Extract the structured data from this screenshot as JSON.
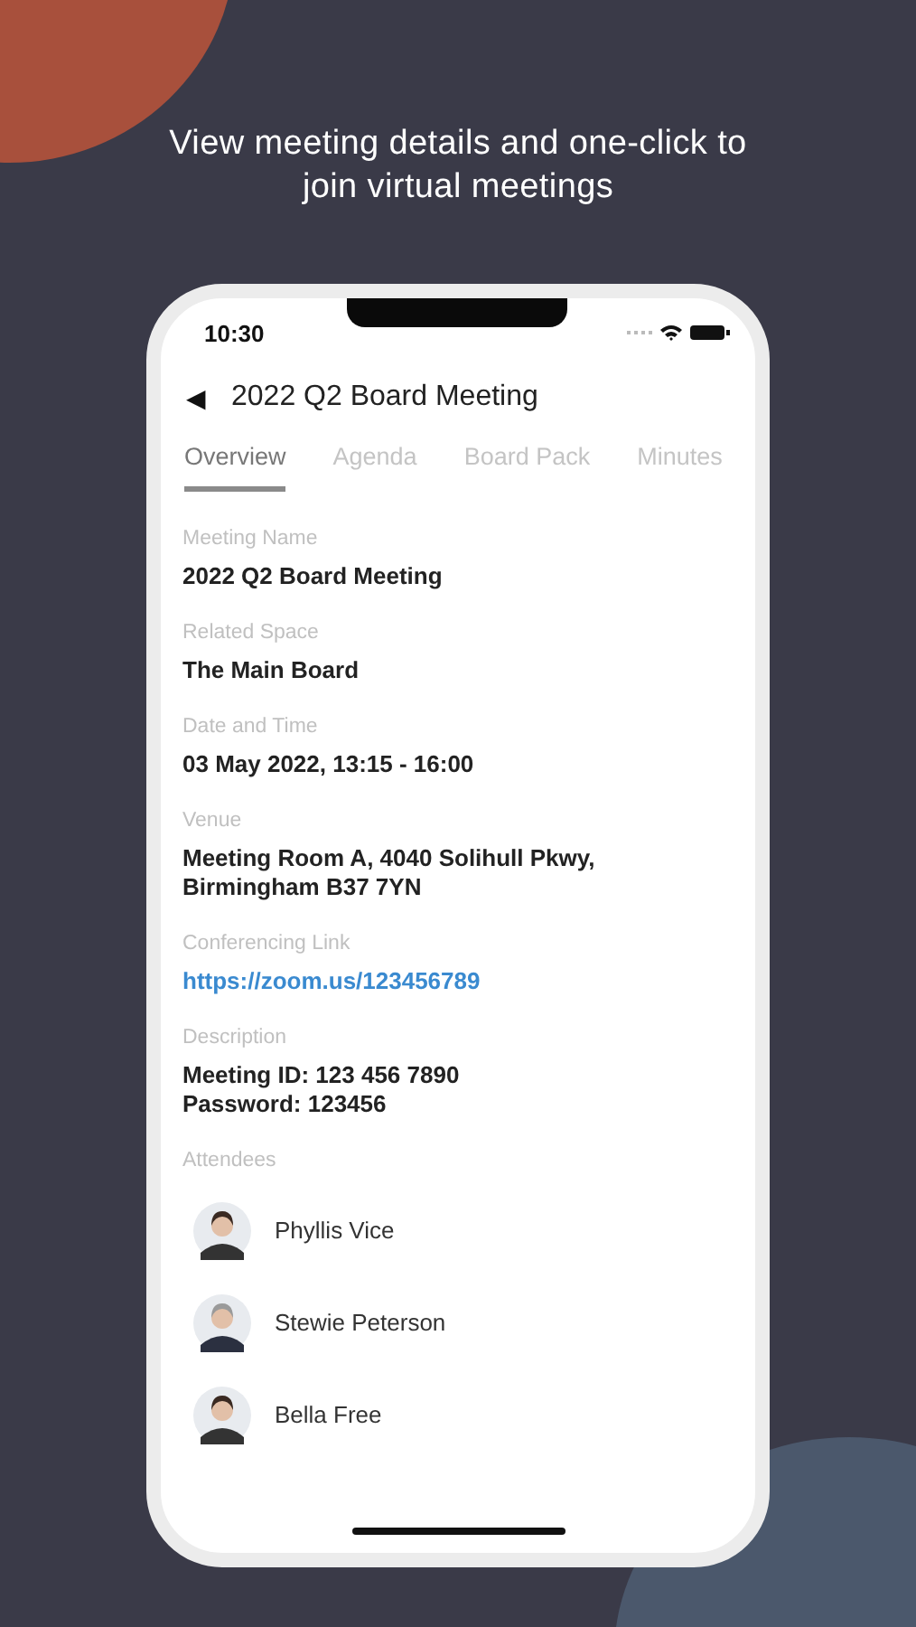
{
  "headline": "View meeting details and one-click to join virtual meetings",
  "status_bar": {
    "time": "10:30"
  },
  "header": {
    "back": "◀",
    "title": "2022 Q2 Board Meeting"
  },
  "tabs": [
    {
      "label": "Overview",
      "selected": true
    },
    {
      "label": "Agenda",
      "selected": false
    },
    {
      "label": "Board Pack",
      "selected": false
    },
    {
      "label": "Minutes",
      "selected": false
    }
  ],
  "fields": [
    {
      "label": "Meeting Name",
      "kind": "text",
      "lines": [
        "2022 Q2 Board Meeting"
      ]
    },
    {
      "label": "Related Space",
      "kind": "text",
      "lines": [
        "The Main Board"
      ]
    },
    {
      "label": "Date and Time",
      "kind": "text",
      "lines": [
        "03 May 2022, 13:15 - 16:00"
      ]
    },
    {
      "label": "Venue",
      "kind": "text",
      "lines": [
        "Meeting Room A, 4040 Solihull Pkwy,",
        "Birmingham B37 7YN"
      ]
    },
    {
      "label": "Conferencing Link",
      "kind": "link",
      "lines": [
        "https://zoom.us/123456789"
      ]
    },
    {
      "label": "Description",
      "kind": "text",
      "lines": [
        "Meeting ID: 123 456 7890",
        "Password: 123456"
      ]
    }
  ],
  "attendees_label": "Attendees",
  "attendees": [
    {
      "name": "Phyllis Vice"
    },
    {
      "name": "Stewie Peterson"
    },
    {
      "name": "Bella Free"
    }
  ]
}
